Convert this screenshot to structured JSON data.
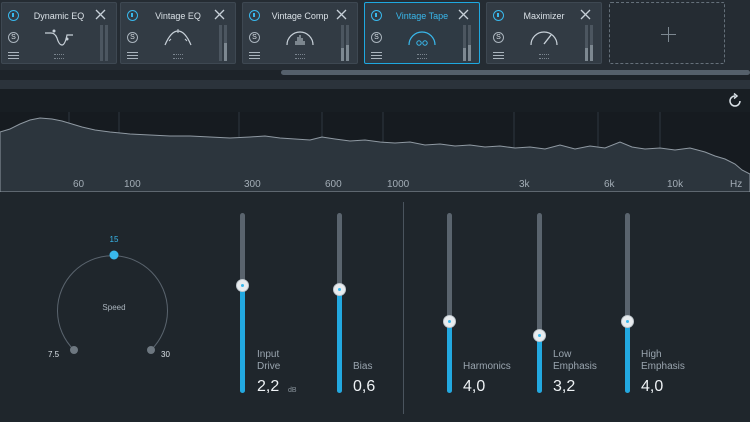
{
  "modules": [
    {
      "title": "Dynamic EQ",
      "active": false,
      "meters": [
        0.0,
        0.0
      ],
      "icon": "dynamic-eq-curve-icon"
    },
    {
      "title": "Vintage EQ",
      "active": false,
      "meters": [
        0.0,
        0.5
      ],
      "icon": "vintage-eq-curve-icon"
    },
    {
      "title": "Vintage Comp",
      "active": false,
      "meters": [
        0.35,
        0.45
      ],
      "icon": "vintage-comp-meter-icon"
    },
    {
      "title": "Vintage Tape",
      "active": true,
      "meters": [
        0.35,
        0.45
      ],
      "icon": "tape-reels-icon"
    },
    {
      "title": "Maximizer",
      "active": false,
      "meters": [
        0.35,
        0.45
      ],
      "icon": "maximizer-gauge-icon"
    }
  ],
  "solo_glyph": "S",
  "frequency_ticks": [
    "60",
    "100",
    "300",
    "600",
    "1000",
    "3k",
    "6k",
    "10k",
    "Hz"
  ],
  "speed": {
    "label": "Speed",
    "selected": "15",
    "min": "7.5",
    "max": "30",
    "value_fraction": 0.5
  },
  "sliders": {
    "input_drive": {
      "label": "Input\nDrive",
      "value": "2,2",
      "unit": "dB",
      "level": 0.6
    },
    "bias": {
      "label": "Bias",
      "value": "0,6",
      "level": 0.58
    },
    "harmonics": {
      "label": "Harmonics",
      "value": "4,0",
      "level": 0.4
    },
    "low_emphasis": {
      "label": "Low\nEmphasis",
      "value": "3,2",
      "level": 0.32
    },
    "high_emphasis": {
      "label": "High\nEmphasis",
      "value": "4,0",
      "level": 0.4
    }
  },
  "colors": {
    "accent": "#39b8ec",
    "slider_fill": "#22a8e0",
    "background": "#1d2329"
  }
}
